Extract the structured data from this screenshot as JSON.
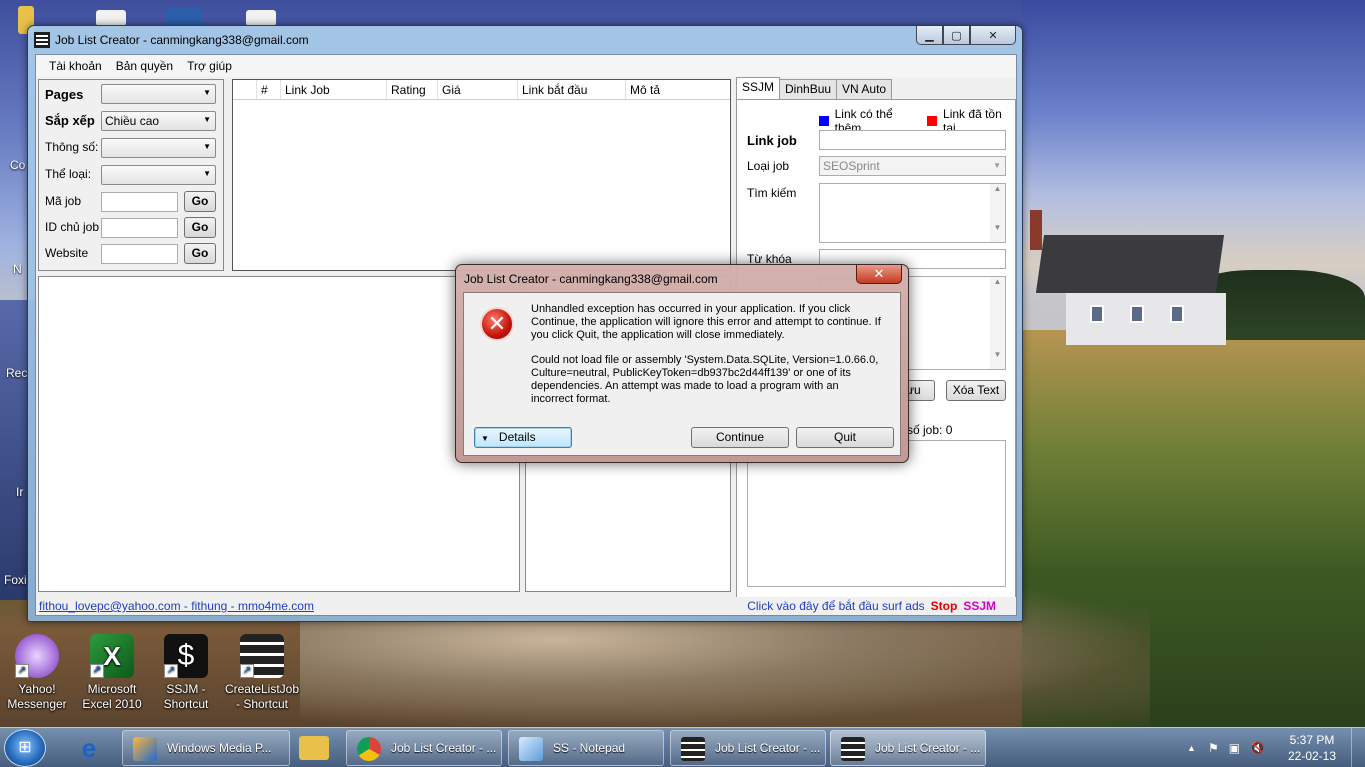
{
  "window": {
    "title": "Job List Creator - canmingkang338@gmail.com",
    "menu": [
      "Tài khoản",
      "Bản quyền",
      "Trợ giúp"
    ]
  },
  "filters": {
    "pages_label": "Pages",
    "sort_label": "Sắp xếp",
    "sort_value": "Chiều cao",
    "params_label": "Thông số:",
    "category_label": "Thể loại:",
    "job_id_label": "Mã job",
    "owner_id_label": "ID chủ job",
    "website_label": "Website",
    "go_label": "Go"
  },
  "grid": {
    "columns": [
      "",
      "#",
      "Link Job",
      "Rating",
      "Giá",
      "Link bắt đầu",
      "Mô tả"
    ]
  },
  "right_panel": {
    "tabs": [
      "SSJM",
      "DinhBuu",
      "VN Auto"
    ],
    "legend_blue": "Link có thể thêm",
    "legend_red": "Link đã tồn tại",
    "link_job_label": "Link job",
    "job_type_label": "Loại job",
    "job_type_value": "SEOSprint",
    "search_label": "Tìm kiếm",
    "keyword_label": "Từ khóa",
    "save_label": "Lưu",
    "clear_text_label": "Xóa Text",
    "job_count_label": "số job: 0",
    "colors": {
      "blue": "#0000ff",
      "red": "#ff0000"
    }
  },
  "status": {
    "link": "fithou_lovepc@yahoo.com - fithung - mmo4me.com",
    "hint": "Click vào đây để bắt đầu surf ads",
    "stop": "Stop",
    "ssjm": "SSJM"
  },
  "dialog": {
    "title": "Job List Creator - canmingkang338@gmail.com",
    "message1": "Unhandled exception has occurred in your application. If you click Continue, the application will ignore this error and attempt to continue. If you click Quit, the application will close immediately.",
    "message2": "Could not load file or assembly 'System.Data.SQLite, Version=1.0.66.0, Culture=neutral, PublicKeyToken=db937bc2d44ff139' or one of its dependencies. An attempt was made to load a program with an incorrect format.",
    "details_label": "Details",
    "continue_label": "Continue",
    "quit_label": "Quit"
  },
  "desktop": {
    "icons": [
      {
        "label": "Yahoo! Messenger",
        "icon": "yahoo-messenger-icon"
      },
      {
        "label": "Microsoft Excel 2010",
        "icon": "excel-icon"
      },
      {
        "label": "SSJM - Shortcut",
        "icon": "ssjm-icon"
      },
      {
        "label": "CreateListJob - Shortcut",
        "icon": "createlistjob-icon"
      }
    ],
    "edge_labels": [
      "Co",
      "N",
      "Rec",
      "Ir",
      "Foxi"
    ]
  },
  "taskbar": {
    "tasks": [
      "Windows Media P...",
      "Job List Creator - ...",
      "SS - Notepad",
      "Job List Creator - ...",
      "Job List Creator - ..."
    ],
    "time": "5:37 PM",
    "date": "22-02-13"
  }
}
